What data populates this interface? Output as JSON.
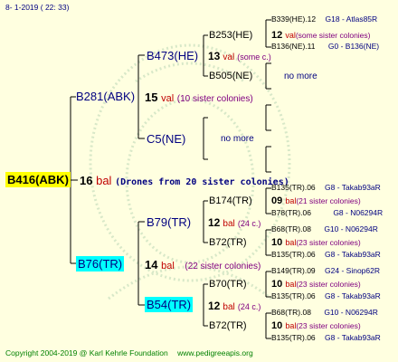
{
  "header": {
    "date": "8-  1-2019 ( 22: 33)"
  },
  "root": {
    "name": "B416(ABK)",
    "num": "16",
    "bal": "bal",
    "drones": "(Drones from 20 sister colonies)"
  },
  "p1": {
    "name": "B281(ABK)",
    "num": "15",
    "val": "val",
    "sis": "(10 sister colonies)"
  },
  "p1a": {
    "name": "B473(HE)",
    "num": "13",
    "val": "val",
    "sis": "(some c.)"
  },
  "p1a1": {
    "name": "B253(HE)",
    "num": "12",
    "val": "val",
    "sis": "(some sister colonies)"
  },
  "p1a1x": {
    "name": "B339(HE).12",
    "tail": "G18 - Atlas85R"
  },
  "p1a1y": {
    "name": "B136(NE).11",
    "tail": "G0 - B136(NE)"
  },
  "p1a2": {
    "name": "B505(NE)",
    "nomore": "no more"
  },
  "p1b": {
    "name": "C5(NE)",
    "nomore": "no more"
  },
  "p2": {
    "name": "B76(TR)",
    "num": "14",
    "bal": "bal",
    "sis": "(22 sister colonies)"
  },
  "p2a": {
    "name": "B79(TR)",
    "num": "12",
    "bal": "bal",
    "sis": "(24 c.)"
  },
  "p2a1": {
    "name": "B174(TR)",
    "num": "09",
    "bal": "bal",
    "sis": "(21 sister colonies)"
  },
  "p2a1x": {
    "name": "B135(TR).06",
    "tail": "G8 - Takab93aR"
  },
  "p2a1y": {
    "name": "B78(TR).06",
    "tail": "G8 - N06294R"
  },
  "p2a2": {
    "name": "B72(TR)",
    "num": "10",
    "bal": "bal",
    "sis": "(23 sister colonies)"
  },
  "p2a2x": {
    "name": "B68(TR).08",
    "tail": "G10 - N06294R"
  },
  "p2a2y": {
    "name": "B135(TR).06",
    "tail": "G8 - Takab93aR"
  },
  "p2b": {
    "name": "B54(TR)",
    "num": "12",
    "bal": "bal",
    "sis": "(24 c.)"
  },
  "p2b1": {
    "name": "B70(TR)",
    "num": "10",
    "bal": "bal",
    "sis": "(23 sister colonies)"
  },
  "p2b1x": {
    "name": "B149(TR).09",
    "tail": "G24 - Sinop62R"
  },
  "p2b1y": {
    "name": "B135(TR).06",
    "tail": "G8 - Takab93aR"
  },
  "p2b2": {
    "name": "B72(TR)",
    "num": "10",
    "bal": "bal",
    "sis": "(23 sister colonies)"
  },
  "p2b2x": {
    "name": "B68(TR).08",
    "tail": "G10 - N06294R"
  },
  "p2b2y": {
    "name": "B135(TR).06",
    "tail": "G8 - Takab93aR"
  },
  "footer": {
    "copyright": "Copyright 2004-2019 @ Karl Kehrle Foundation",
    "url": "www.pedigreeapis.org"
  },
  "colors": {
    "background": "#ffffe0",
    "root_highlight": "#ffff00",
    "cyan_highlight": "#00ffff",
    "bal": "#c00000",
    "val": "#c00000",
    "sister": "#800080",
    "tail": "#000080",
    "green_text": "#008000"
  }
}
